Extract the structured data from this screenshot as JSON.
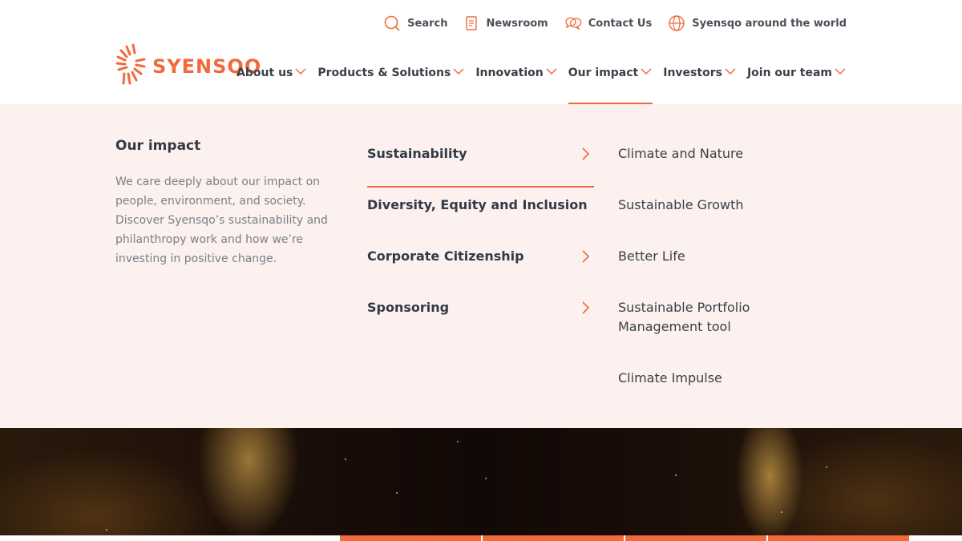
{
  "brand": {
    "name": "SYENSQO",
    "accent_color": "#f06a3b",
    "logo_icon": "syensqo-sunburst-icon"
  },
  "utility": [
    {
      "label": "Search",
      "icon": "search-icon"
    },
    {
      "label": "Newsroom",
      "icon": "newsroom-icon"
    },
    {
      "label": "Contact Us",
      "icon": "chat-icon"
    },
    {
      "label": "Syensqo around the world",
      "icon": "globe-icon"
    }
  ],
  "nav": [
    {
      "label": "About us"
    },
    {
      "label": "Products & Solutions"
    },
    {
      "label": "Innovation"
    },
    {
      "label": "Our impact",
      "active": true
    },
    {
      "label": "Investors"
    },
    {
      "label": "Join our team"
    }
  ],
  "menu": {
    "title": "Our impact",
    "description": "We care deeply about our impact on people, environment, and society. Discover Syensqo’s sustainability and philanthropy work and how we’re investing in positive change.",
    "categories": [
      {
        "label": "Sustainability",
        "has_children": true,
        "active": true
      },
      {
        "label": "Diversity, Equity and Inclusion",
        "has_children": false
      },
      {
        "label": "Corporate Citizenship",
        "has_children": true
      },
      {
        "label": "Sponsoring",
        "has_children": true
      }
    ],
    "subitems": [
      "Climate and Nature",
      "Sustainable Growth",
      "Better Life",
      "Sustainable Portfolio Management tool",
      "Climate Impulse"
    ]
  }
}
